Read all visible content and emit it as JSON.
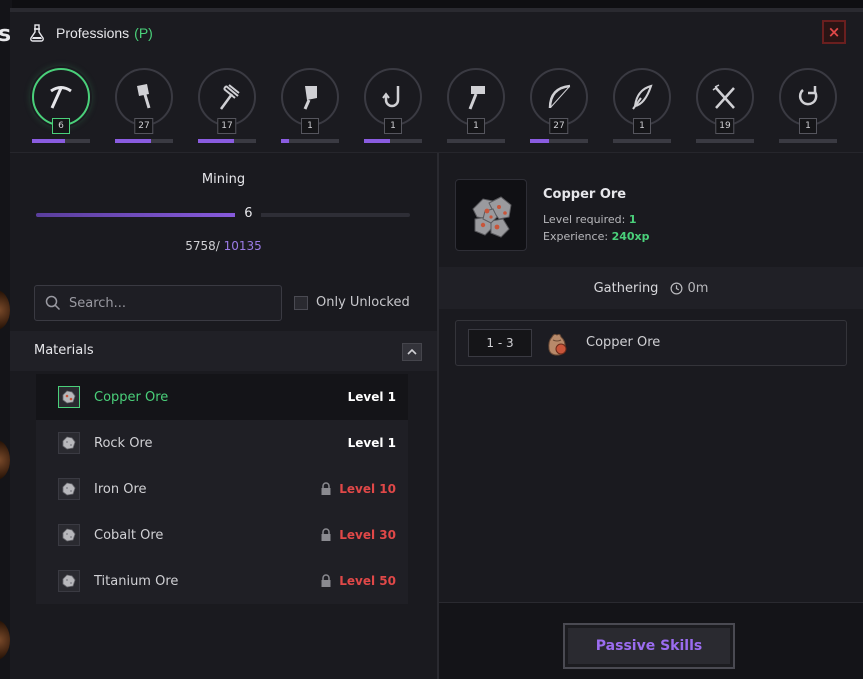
{
  "window": {
    "title": "Professions",
    "hotkey": "(P)",
    "close_label": "×"
  },
  "professions": [
    {
      "name": "mining",
      "icon": "pickaxe-icon",
      "level": "6",
      "progress": 0.57,
      "active": true
    },
    {
      "name": "woodcutting",
      "icon": "axe-icon",
      "level": "27",
      "progress": 0.62,
      "active": false
    },
    {
      "name": "farming",
      "icon": "pitchfork-icon",
      "level": "17",
      "progress": 0.62,
      "active": false
    },
    {
      "name": "butchering",
      "icon": "cleaver-icon",
      "level": "1",
      "progress": 0.14,
      "active": false
    },
    {
      "name": "fishing",
      "icon": "hook-icon",
      "level": "1",
      "progress": 0.45,
      "active": false
    },
    {
      "name": "smithing",
      "icon": "hammer-icon",
      "level": "1",
      "progress": 0.0,
      "active": false
    },
    {
      "name": "bowcraft",
      "icon": "bow-icon",
      "level": "27",
      "progress": 0.33,
      "active": false
    },
    {
      "name": "alchemy",
      "icon": "quill-icon",
      "level": "1",
      "progress": 0.0,
      "active": false
    },
    {
      "name": "cooking",
      "icon": "utensils-icon",
      "level": "19",
      "progress": 0.0,
      "active": false
    },
    {
      "name": "tinkering",
      "icon": "rotate-icon",
      "level": "1",
      "progress": 0.0,
      "active": false
    }
  ],
  "skill": {
    "name": "Mining",
    "level": "6",
    "xp_current": "5758",
    "xp_sep": "/ ",
    "xp_max": "10135",
    "xp_fraction": 0.568
  },
  "filters": {
    "search_placeholder": "Search...",
    "only_unlocked_label": "Only Unlocked",
    "only_unlocked_checked": false
  },
  "materials": {
    "header": "Materials",
    "items": [
      {
        "name": "Copper Ore",
        "level": "Level 1",
        "locked": false,
        "selected": true
      },
      {
        "name": "Rock Ore",
        "level": "Level 1",
        "locked": false,
        "selected": false
      },
      {
        "name": "Iron Ore",
        "level": "Level 10",
        "locked": true,
        "selected": false
      },
      {
        "name": "Cobalt Ore",
        "level": "Level 30",
        "locked": true,
        "selected": false
      },
      {
        "name": "Titanium Ore",
        "level": "Level 50",
        "locked": true,
        "selected": false
      }
    ]
  },
  "detail": {
    "name": "Copper Ore",
    "level_required_label": "Level required:",
    "level_required_value": "1",
    "experience_label": "Experience:",
    "experience_value": "240xp",
    "gathering_label": "Gathering",
    "gathering_time": "0m",
    "reward": {
      "qty": "1 - 3",
      "name": "Copper Ore"
    }
  },
  "passive_button": "Passive Skills",
  "colors": {
    "accent_green": "#4ad07a",
    "accent_purple": "#8a5ce0",
    "danger_red": "#e04848"
  }
}
